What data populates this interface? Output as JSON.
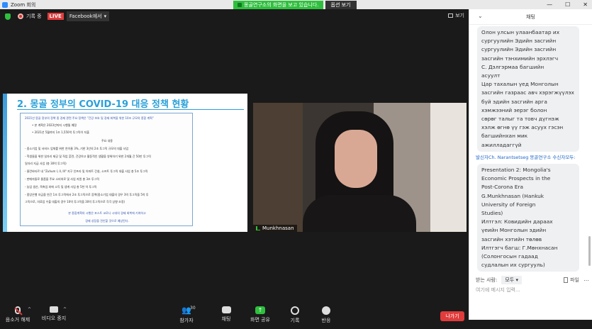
{
  "window": {
    "title": "Zoom 회의",
    "controls": [
      "—",
      "☐",
      "✕"
    ]
  },
  "share_banner": {
    "message": "몽골연구소의 화면을 보고 있습니다.",
    "options_label": "옵션 보기"
  },
  "topbar": {
    "rec_label": "기록 중",
    "live_label": "LIVE",
    "facebook_label": "Facebook에서",
    "view_label": "보기"
  },
  "slide": {
    "title": "2. 몽골 정부의 COVID-19 대응 정책 현황",
    "lines": [
      "2021년 몽골 정부의 정책 중 경제 관련 주요 정책은 \"건강 보호 및 경제 회복을 위한 10조 규모의 종합 계획\"",
      "• 본 계획은 2023년까지 시행될 예정",
      "• 2021년 5월까지 1조 1,550억 투그릭이 지출",
      "주요 내용",
      "- 중소기업 및 서비스 업체를 위한 연이율 3%, 기한 3년의 2조 투그릭 규모의 대출 사업",
      "- 학생들을 위한 일자리 제공 및 직업 훈련, 건강하고 활동적인 생활을 영위하기 위한 2개월 간 50만 투그릭",
      "  일자리 지급 사업 (총 30억 투그릭)",
      "- 울란바타르 내 \"Zuhum I, II, III\" 지구 인프라 및 아파트 건설, 소프트 투그릭 대출 사업 총 5조 투그릭",
      "- 판매자들로 물품을 주요 소비처로 및 사업 지원 총 3조 투그릭",
      "- 농업 생산, 목축업 외에 소득 및 생계 사업 총 5천 억 투그릭",
      "- 중앙은행 자금을 연간 1조 투그릭에서 2조 투그릭으로 증액(중소기업 대출의 경우 3억 투그릭을 5억 투",
      "  그릭으로, 의료업 수출 대출의 경우 10억 투그릭을 30억 투그릭으로 각각 상향 조정)",
      "본 종합계획의 시행은 포스트 코로나 시대의 경제 회복에 기여하고",
      "경제 성장을 견인할 것으로 예상된다."
    ]
  },
  "video": {
    "participant_name": "Munkhnasan"
  },
  "toolbar": {
    "mute": "음소거 해제",
    "video": "비디오 중지",
    "participants": "참가자",
    "participants_count": "30",
    "chat": "채팅",
    "share": "화면 공유",
    "record": "기록",
    "reactions": "반응",
    "leave": "나가기"
  },
  "chat": {
    "title": "채팅",
    "message1_lines": [
      "Олон улсын улаанбаатар их",
      "сургуулийн Эдийн засгийн",
      "сургуулийн Эдийн засгийн",
      "засгийн тэнхимийн эрхлэгч",
      "С. Дэлгэрмаа багшийн",
      "асуулт",
      "Цар тахалын үед Монголын",
      "засгийн газраас авч хэрэгжүүлэх",
      "бүй эдийн засгийн арга",
      "хэмжээний эерэг болон",
      "сөрөг талыг та товч дүгнэж",
      "хэлж өгнө үү гэж асуух гэсэн",
      "багшийнхан мик",
      "ажилладаггүй"
    ],
    "sender2": "발신자Ch. Narantsetseg 몽골연구소 수신자모두:",
    "message2_lines": [
      "Presentation 2: Mongolia's",
      "Economic Prospects in the",
      "Post-Corona Era",
      "G.Munkhnasan (Hankuk",
      "University of Foreign",
      "Studies)",
      "Илтгэл: Ковидийн дараах",
      "үеийн Монголын эдийн",
      "засгийн хэтийн төлөв",
      "Илтгэгч багш: Г.Мөнхнасан",
      "(Солонгосын гадаад",
      "судлалын их сургууль)"
    ],
    "to_label": "받는 사람:",
    "to_value": "모두",
    "file_label": "파일",
    "input_placeholder": "여기에 메시지 입력..."
  },
  "colors": {
    "accent_green": "#2fbf3e",
    "live_red": "#e03c3c",
    "slide_blue": "#2aa0d8"
  }
}
